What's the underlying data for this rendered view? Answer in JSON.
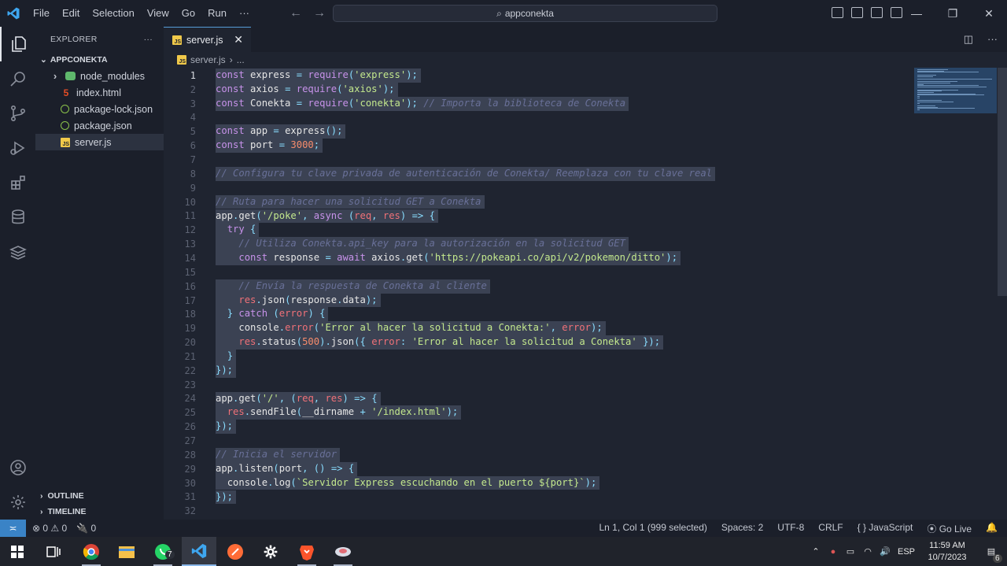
{
  "titlebar": {
    "menu": [
      "File",
      "Edit",
      "Selection",
      "View",
      "Go",
      "Run",
      "···"
    ],
    "search": "appconekta"
  },
  "activity": [
    "explorer-icon",
    "search-icon",
    "source-control-icon",
    "run-debug-icon",
    "extensions-icon",
    "database-icon",
    "stack-icon",
    "account-icon",
    "gear-icon"
  ],
  "sidebar": {
    "header": "EXPLORER",
    "more": "···",
    "root": "APPCONEKTA",
    "items": [
      {
        "label": "node_modules",
        "icon": "folder-icon",
        "chevron": "›"
      },
      {
        "label": "index.html",
        "icon": "html-icon"
      },
      {
        "label": "package-lock.json",
        "icon": "npm-icon"
      },
      {
        "label": "package.json",
        "icon": "npm-icon"
      },
      {
        "label": "server.js",
        "icon": "js-icon"
      }
    ],
    "outline": "OUTLINE",
    "timeline": "TIMELINE"
  },
  "editor": {
    "tab": "server.js",
    "tab_close": "✕",
    "breadcrumb_file": "server.js",
    "breadcrumb_rest": "...",
    "lines": [
      "const express = require('express');",
      "const axios = require('axios');",
      "const Conekta = require('conekta'); // Importa la biblioteca de Conekta",
      "",
      "const app = express();",
      "const port = 3000;",
      "",
      "// Configura tu clave privada de autenticación de Conekta/ Reemplaza con tu clave real",
      "",
      "// Ruta para hacer una solicitud GET a Conekta",
      "app.get('/poke', async (req, res) => {",
      "  try {",
      "    // Utiliza Conekta.api_key para la autorización en la solicitud GET",
      "    const response = await axios.get('https://pokeapi.co/api/v2/pokemon/ditto');",
      "",
      "    // Envía la respuesta de Conekta al cliente",
      "    res.json(response.data);",
      "  } catch (error) {",
      "    console.error('Error al hacer la solicitud a Conekta:', error);",
      "    res.status(500).json({ error: 'Error al hacer la solicitud a Conekta' });",
      "  }",
      "});",
      "",
      "app.get('/', (req, res) => {",
      "  res.sendFile(__dirname + '/index.html');",
      "});",
      "",
      "// Inicia el servidor",
      "app.listen(port, () => {",
      "  console.log(`Servidor Express escuchando en el puerto ${port}`);",
      "});",
      ""
    ]
  },
  "status": {
    "errors": "⊗ 0 ⚠ 0",
    "ports": "🔌 0",
    "position": "Ln 1, Col 1 (999 selected)",
    "spaces": "Spaces: 2",
    "encoding": "UTF-8",
    "eol": "CRLF",
    "language": "{ } JavaScript",
    "golive": "Go Live"
  },
  "taskbar": {
    "whatsapp_badge": "7",
    "language": "ESP",
    "time": "11:59 AM",
    "date": "10/7/2023",
    "notifications": "6"
  },
  "colors": {
    "keyword": "#c792ea",
    "var": "#82aaff",
    "func": "#82aaff",
    "string": "#c3e88d",
    "comment": "#697098",
    "number": "#f78c6c",
    "punct": "#89ddff",
    "param": "#f07178"
  }
}
